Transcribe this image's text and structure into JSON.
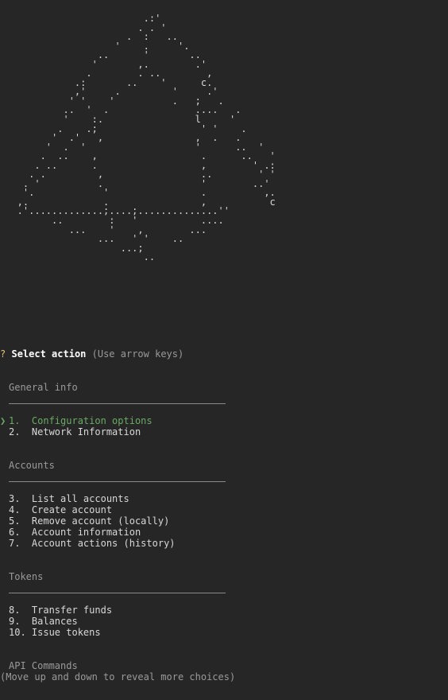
{
  "banner_art": "                         .:'\n                        . . '\n                      .  :   ..\n                    '    .     '.\n                 ..      '       ..\n                '       ,.        .'\n               .        . ..        ,\n             .:       ..    '      c.\n             ,'     .         '     .'\n            ' '    '          .   ;   .\n           ..  '  .               ....   .\n           '    :.                l     '\n          .    .;                  ' '    .\n         '  .'   ,                ,  .   .\n        '  .  '                   '      ..  '\n       .  ..    ,                  .      ..   '\n      . ..      .                  ,        ' .:\n     . .         ,                 ..        ' '\n    . '          .                 '        ..'\n    '.            '                .          ,.\n   ,.             .                ,           c\n   .'.............;....;..............''\n         ..        :   '           ....\n            ...    '    ,        ...\n                 ...   ' '    ..\n                     ...;\n                         ..",
  "prompt": {
    "marker": "?",
    "message": "Select action",
    "hint": "(Use arrow keys)"
  },
  "sections": {
    "general": "General info",
    "accounts": "Accounts",
    "tokens": "Tokens",
    "api": "API Commands"
  },
  "pointer": "❯",
  "choices": [
    "1.  Configuration options",
    "2.  Network Information",
    "3.  List all accounts",
    "4.  Create account",
    "5.  Remove account (locally)",
    "6.  Account information",
    "7.  Account actions (history)",
    "8.  Transfer funds",
    "9.  Balances",
    "10. Issue tokens"
  ],
  "footer_hint": "(Move up and down to reveal more choices)",
  "colors": {
    "background": "#262626",
    "selected": "#6aaa64",
    "prompt_marker": "#e5c07b",
    "dim": "#9a9a9a"
  }
}
